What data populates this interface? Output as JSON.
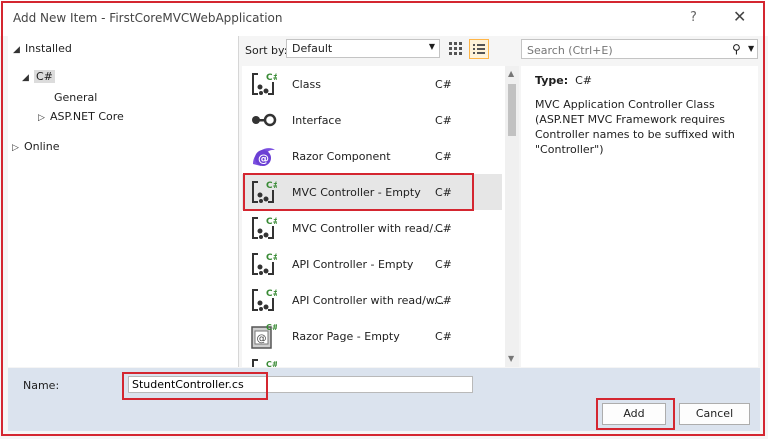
{
  "window": {
    "title": "Add New Item - FirstCoreMVCWebApplication",
    "help": "?",
    "close": "✕"
  },
  "tree": {
    "installed": "Installed",
    "csharp": "C#",
    "general": "General",
    "aspnetcore": "ASP.NET Core",
    "online": "Online"
  },
  "toolbar": {
    "sort_label": "Sort by:",
    "sort_value": "Default"
  },
  "search": {
    "placeholder": "Search (Ctrl+E)"
  },
  "templates": [
    {
      "label": "Class",
      "lang": "C#"
    },
    {
      "label": "Interface",
      "lang": "C#"
    },
    {
      "label": "Razor Component",
      "lang": "C#"
    },
    {
      "label": "MVC Controller - Empty",
      "lang": "C#"
    },
    {
      "label": "MVC Controller with read/...",
      "lang": "C#"
    },
    {
      "label": "API Controller - Empty",
      "lang": "C#"
    },
    {
      "label": "API Controller with read/w...",
      "lang": "C#"
    },
    {
      "label": "Razor Page - Empty",
      "lang": "C#"
    }
  ],
  "details": {
    "type_label": "Type:",
    "type_value": "C#",
    "description": "MVC Application Controller Class (ASP.NET MVC Framework requires Controller names to be suffixed with \"Controller\")"
  },
  "footer": {
    "name_label": "Name:",
    "name_value": "StudentController.cs",
    "add_label": "Add",
    "cancel_label": "Cancel"
  },
  "colors": {
    "highlight": "#d42630",
    "footer_bg": "#dbe3ee",
    "razor_purple": "#6b3fd4"
  }
}
